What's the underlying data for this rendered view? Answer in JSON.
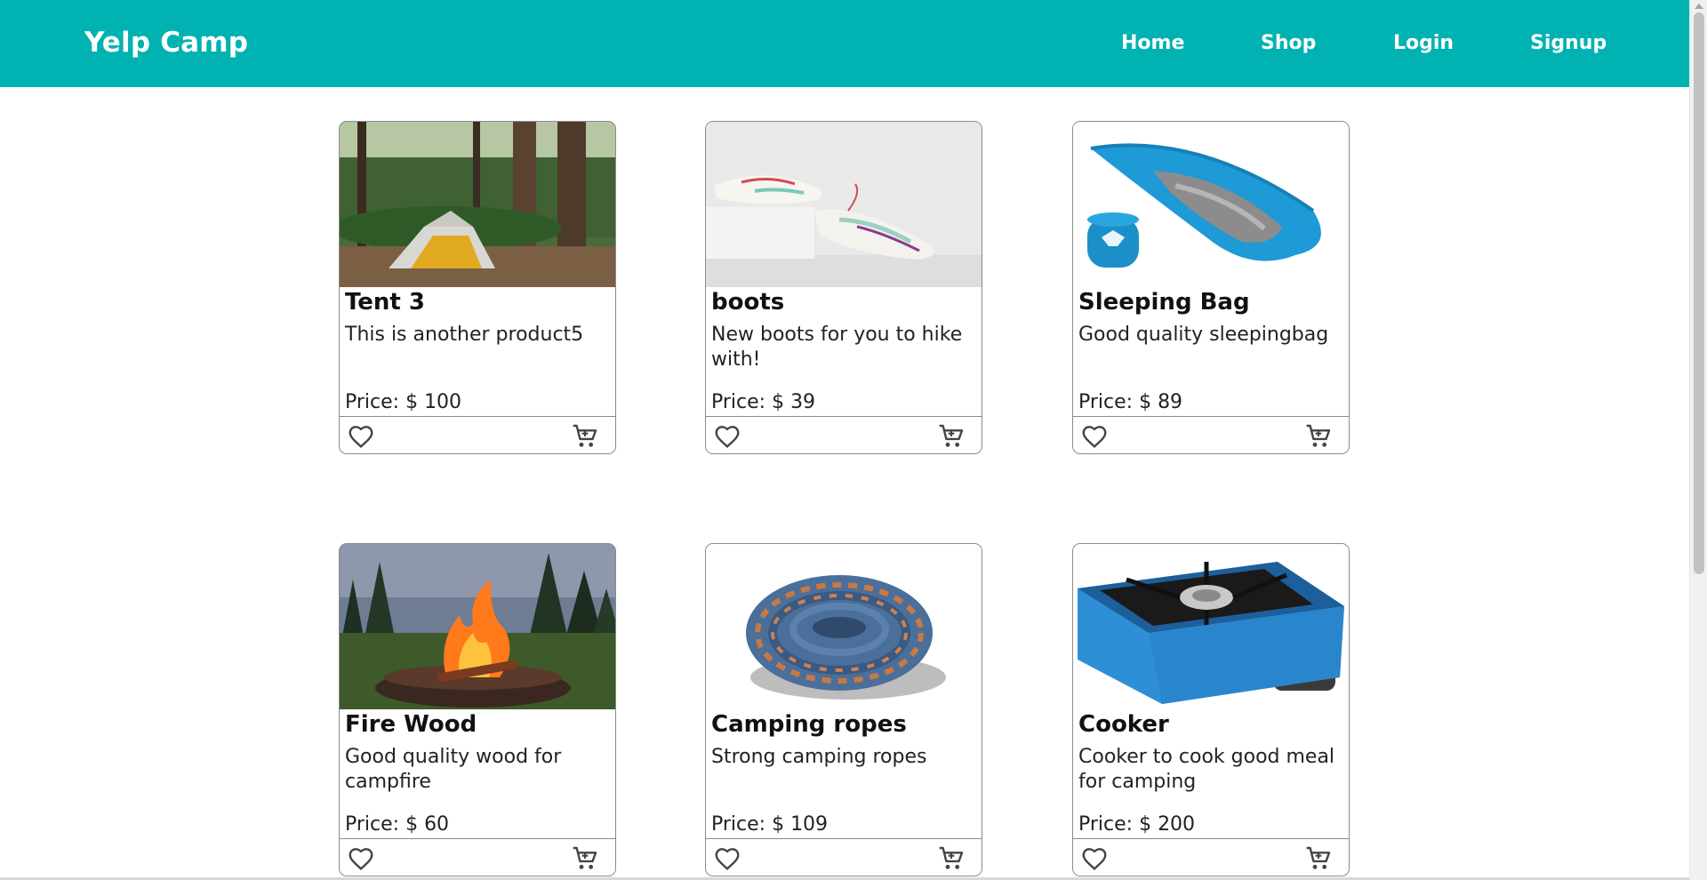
{
  "navbar": {
    "brand": "Yelp Camp",
    "links": [
      {
        "label": "Home"
      },
      {
        "label": "Shop"
      },
      {
        "label": "Login"
      },
      {
        "label": "Signup"
      }
    ]
  },
  "products": [
    {
      "title": "Tent 3",
      "description": "This is another product5",
      "price": "Price: $ 100",
      "image": "tent-in-forest"
    },
    {
      "title": "boots",
      "description": "New boots for you to hike with!",
      "price": "Price: $ 39",
      "image": "white-hiking-boots"
    },
    {
      "title": "Sleeping Bag",
      "description": "Good quality sleepingbag",
      "price": "Price: $ 89",
      "image": "blue-sleeping-bag"
    },
    {
      "title": "Fire Wood",
      "description": "Good quality wood for campfire",
      "price": "Price: $ 60",
      "image": "campfire-fire-pit"
    },
    {
      "title": "Camping ropes",
      "description": "Strong camping ropes",
      "price": "Price: $ 109",
      "image": "coiled-rope"
    },
    {
      "title": "Cooker",
      "description": "Cooker to cook good meal for camping",
      "price": "Price: $ 200",
      "image": "portable-gas-stove"
    }
  ],
  "icons": {
    "favorite": "heart-icon",
    "cart": "cart-icon"
  },
  "colors": {
    "navbar": "#00b2b2",
    "nav_text": "#ffffff",
    "card_border": "#8a8a8a"
  }
}
